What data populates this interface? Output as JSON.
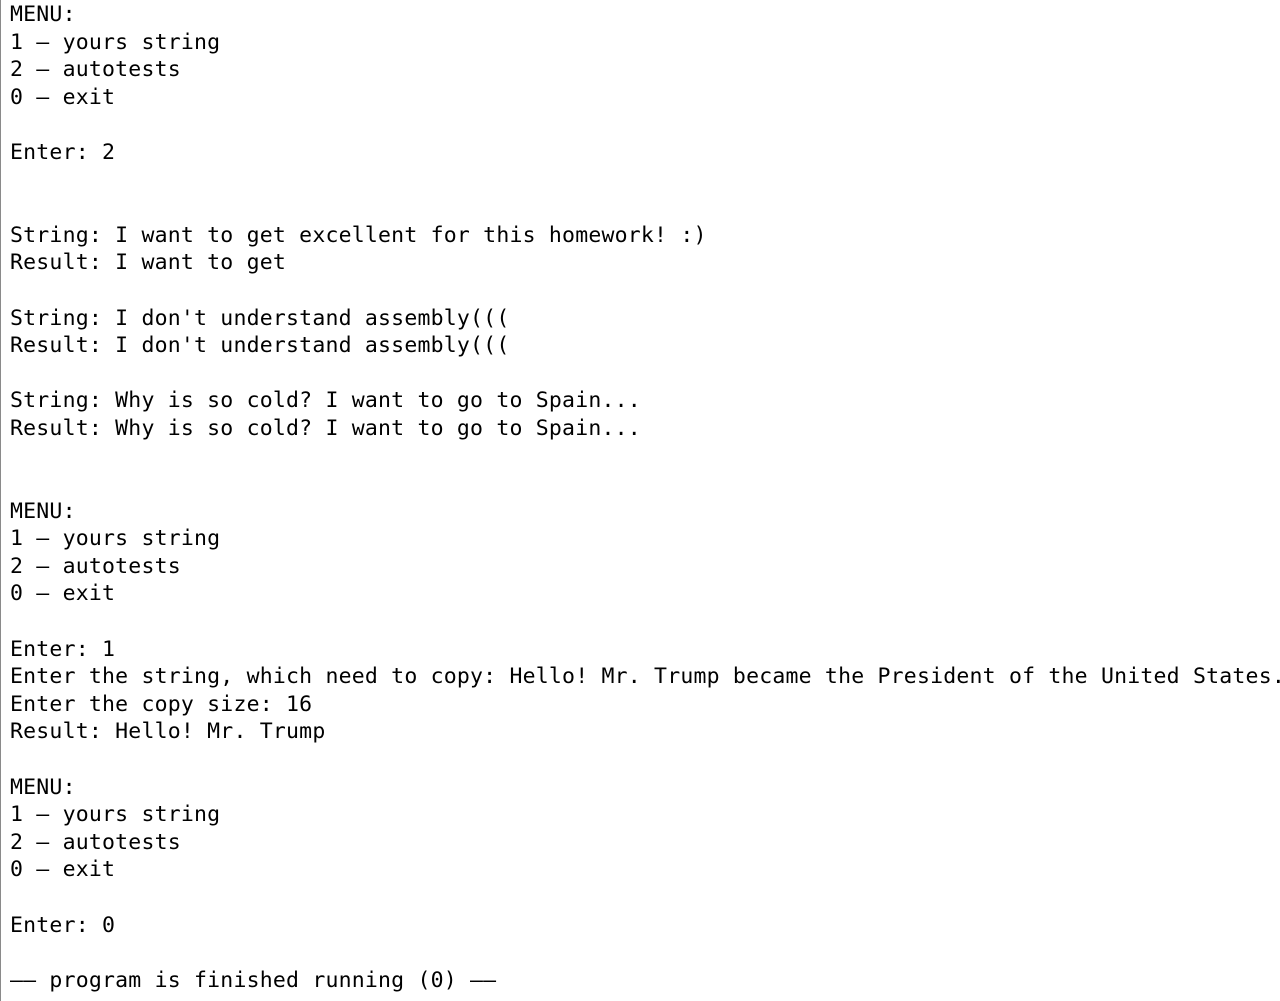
{
  "console": {
    "lines": [
      "MENU:",
      "1 – yours string",
      "2 – autotests",
      "0 – exit",
      "",
      "Enter: 2",
      "",
      "",
      "String: I want to get excellent for this homework! :)",
      "Result: I want to get",
      "",
      "String: I don't understand assembly(((",
      "Result: I don't understand assembly(((",
      "",
      "String: Why is so cold? I want to go to Spain...",
      "Result: Why is so cold? I want to go to Spain...",
      "",
      "",
      "MENU:",
      "1 – yours string",
      "2 – autotests",
      "0 – exit",
      "",
      "Enter: 1",
      "Enter the string, which need to copy: Hello! Mr. Trump became the President of the United States.",
      "Enter the copy size: 16",
      "Result: Hello! Mr. Trump",
      "",
      "MENU:",
      "1 – yours string",
      "2 – autotests",
      "0 – exit",
      "",
      "Enter: 0",
      "",
      "–– program is finished running (0) ––"
    ]
  }
}
